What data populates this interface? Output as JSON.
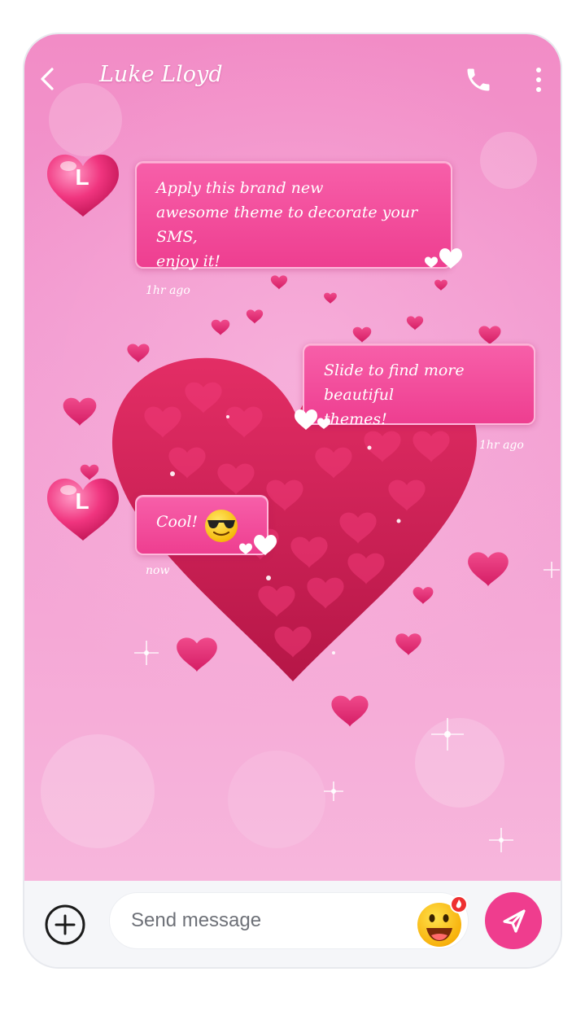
{
  "header": {
    "contact_name": "Luke Lloyd"
  },
  "avatar_letter": "L",
  "messages": [
    {
      "direction": "incoming",
      "lines": [
        "Apply this brand new",
        "awesome theme to decorate your SMS,",
        "enjoy it!"
      ],
      "time": "1hr ago"
    },
    {
      "direction": "outgoing",
      "lines": [
        "Slide to find more beautiful",
        "themes!"
      ],
      "time": "1hr ago"
    },
    {
      "direction": "incoming",
      "text": "Cool!",
      "emoji": "sunglasses-emoji",
      "time": "now"
    }
  ],
  "compose": {
    "placeholder": "Send message",
    "value": ""
  },
  "icons": {
    "back": "chevron-left-icon",
    "call": "phone-icon",
    "more": "more-vertical-icon",
    "add": "plus-circle-icon",
    "emoji": "emoji-icon",
    "send": "send-icon"
  },
  "colors": {
    "background_pink": "#f29ad0",
    "bubble_pink": "#ef3d8e",
    "send_button": "#ef3d8e",
    "compose_bar": "#f5f6f9"
  }
}
